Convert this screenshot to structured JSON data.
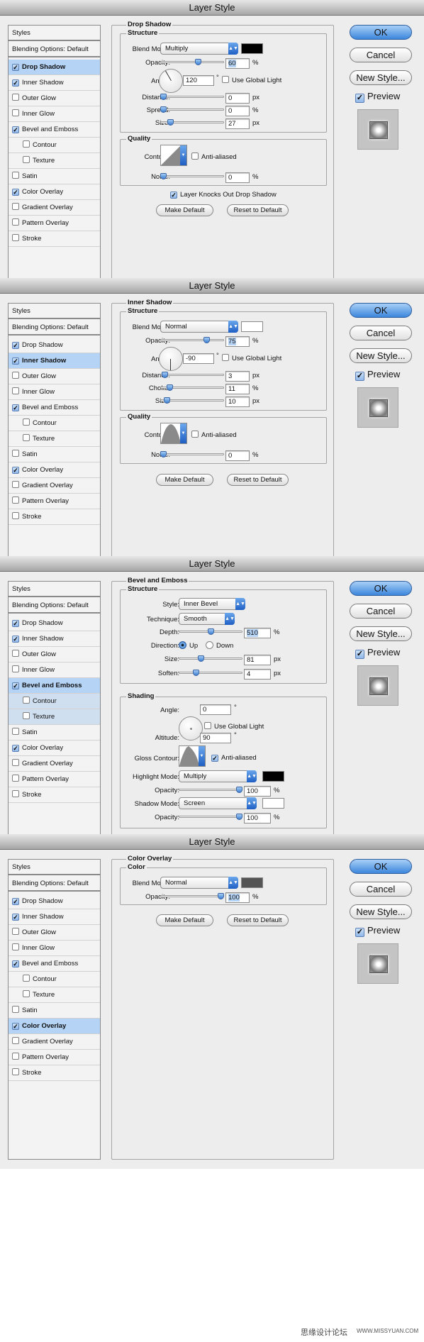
{
  "common": {
    "dialog_title": "Layer Style",
    "ok": "OK",
    "cancel": "Cancel",
    "new_style": "New Style...",
    "preview": "Preview",
    "make_default": "Make Default",
    "reset_default": "Reset to Default",
    "sidebar": [
      {
        "label": "Styles",
        "checkbox": false,
        "checked": false
      },
      {
        "label": "Blending Options: Default",
        "checkbox": false,
        "checked": false
      },
      {
        "label": "Drop Shadow",
        "checkbox": true,
        "checked": true
      },
      {
        "label": "Inner Shadow",
        "checkbox": true,
        "checked": true
      },
      {
        "label": "Outer Glow",
        "checkbox": true,
        "checked": false
      },
      {
        "label": "Inner Glow",
        "checkbox": true,
        "checked": false
      },
      {
        "label": "Bevel and Emboss",
        "checkbox": true,
        "checked": true
      },
      {
        "label": "Contour",
        "checkbox": true,
        "checked": false
      },
      {
        "label": "Texture",
        "checkbox": true,
        "checked": false
      },
      {
        "label": "Satin",
        "checkbox": true,
        "checked": false
      },
      {
        "label": "Color Overlay",
        "checkbox": true,
        "checked": true
      },
      {
        "label": "Gradient Overlay",
        "checkbox": true,
        "checked": false
      },
      {
        "label": "Pattern Overlay",
        "checkbox": true,
        "checked": false
      },
      {
        "label": "Stroke",
        "checkbox": true,
        "checked": false
      }
    ]
  },
  "dialogs": [
    {
      "selected_index": 2,
      "section": "Drop Shadow",
      "structure": "Structure",
      "blend_label": "Blend Mode:",
      "blend_value": "Multiply",
      "swatch_color": "#000000",
      "opacity_label": "Opacity:",
      "opacity": "60",
      "opacity_level": 0.6,
      "angle_label": "Angle:",
      "angle": "120",
      "use_global": "Use Global Light",
      "distance_label": "Distance:",
      "distance": "0",
      "distance_level": 0,
      "spread_label": "Spread:",
      "spread": "0",
      "spread_level": 0,
      "size_label": "Size:",
      "size": "27",
      "size_level": 0.12,
      "quality": "Quality",
      "contour_label": "Contour:",
      "anti_aliased": "Anti-aliased",
      "noise_label": "Noise:",
      "noise": "0",
      "noise_level": 0,
      "knockout": "Layer Knocks Out Drop Shadow",
      "unit_pct": "%",
      "unit_px": "px",
      "deg": "°"
    },
    {
      "selected_index": 3,
      "section": "Inner Shadow",
      "structure": "Structure",
      "blend_label": "Blend Mode:",
      "blend_value": "Normal",
      "swatch_color": "#ffffff",
      "opacity_label": "Opacity:",
      "opacity": "75",
      "opacity_level": 0.75,
      "angle_label": "Angle:",
      "angle": "-90",
      "use_global": "Use Global Light",
      "distance_label": "Distance:",
      "distance": "3",
      "distance_level": 0.03,
      "choke_label": "Choke:",
      "choke": "11",
      "choke_level": 0.11,
      "size_label": "Size:",
      "size": "10",
      "size_level": 0.06,
      "quality": "Quality",
      "contour_label": "Contour:",
      "anti_aliased": "Anti-aliased",
      "noise_label": "Noise:",
      "noise": "0",
      "noise_level": 0,
      "unit_pct": "%",
      "unit_px": "px",
      "deg": "°"
    },
    {
      "selected_index": 6,
      "section": "Bevel and Emboss",
      "structure": "Structure",
      "style_label": "Style:",
      "style_value": "Inner Bevel",
      "technique_label": "Technique:",
      "technique_value": "Smooth",
      "depth_label": "Depth:",
      "depth": "510",
      "depth_level": 0.5,
      "direction_label": "Direction:",
      "dir_up": "Up",
      "dir_down": "Down",
      "size_label": "Size:",
      "size": "81",
      "size_level": 0.33,
      "soften_label": "Soften:",
      "soften": "4",
      "soften_level": 0.25,
      "shading": "Shading",
      "angle_label": "Angle:",
      "angle": "0",
      "use_global": "Use Global Light",
      "altitude_label": "Altitude:",
      "altitude": "90",
      "gloss_label": "Gloss Contour:",
      "anti_aliased": "Anti-aliased",
      "hl_mode_label": "Highlight Mode:",
      "hl_mode": "Multiply",
      "hl_color": "#000000",
      "hl_opacity_label": "Opacity:",
      "hl_opacity": "100",
      "hl_opacity_level": 1,
      "sh_mode_label": "Shadow Mode:",
      "sh_mode": "Screen",
      "sh_color": "#ffffff",
      "sh_opacity_label": "Opacity:",
      "sh_opacity": "100",
      "sh_opacity_level": 1,
      "unit_pct": "%",
      "unit_px": "px",
      "deg": "°"
    },
    {
      "selected_index": 10,
      "section": "Color Overlay",
      "color": "Color",
      "blend_label": "Blend Mode:",
      "blend_value": "Normal",
      "swatch_color": "#555555",
      "opacity_label": "Opacity:",
      "opacity": "100",
      "opacity_level": 1,
      "unit_pct": "%"
    }
  ],
  "watermark": "思缘设计论坛",
  "watermark_url": "WWW.MISSYUAN.COM"
}
